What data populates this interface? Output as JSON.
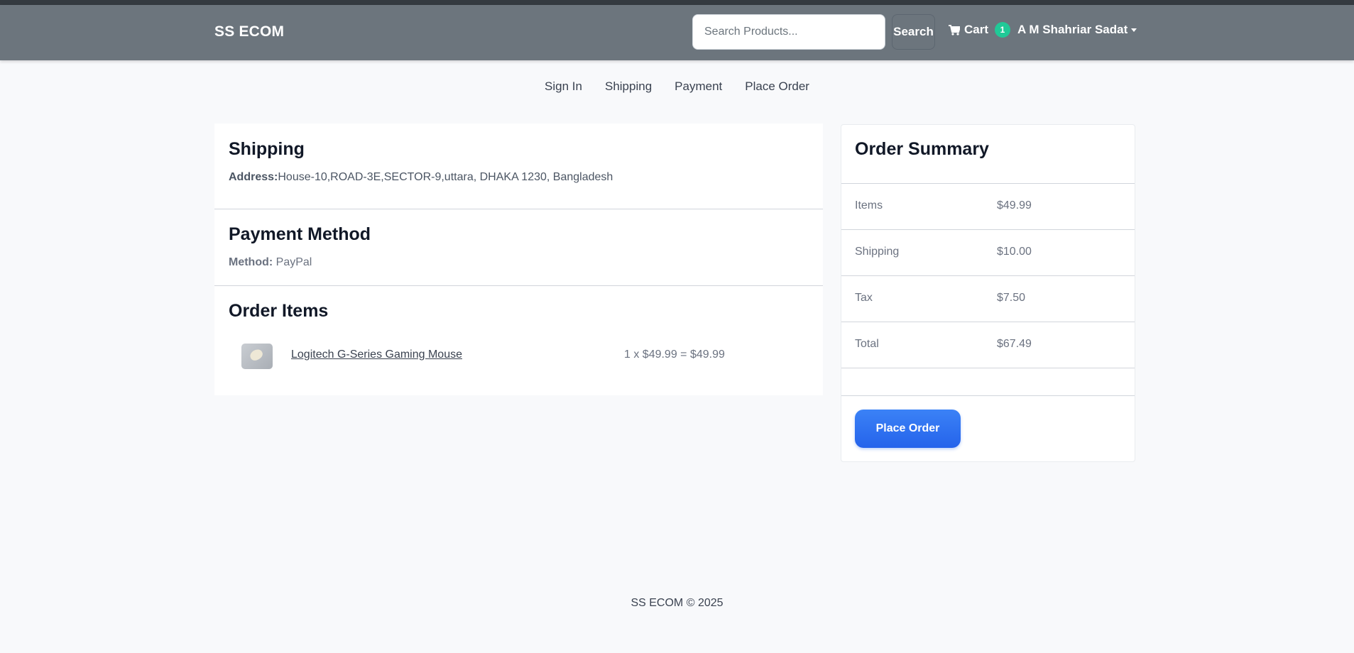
{
  "navbar": {
    "brand": "SS ECOM",
    "search": {
      "placeholder": "Search Products...",
      "button_label": "Search"
    },
    "cart": {
      "label": "Cart",
      "count": "1",
      "icon": "cart-icon"
    },
    "user": {
      "name": "A M Shahriar Sadat"
    }
  },
  "steps": [
    "Sign In",
    "Shipping",
    "Payment",
    "Place Order"
  ],
  "shipping": {
    "title": "Shipping",
    "address_label": "Address:",
    "address_value": "House-10,ROAD-3E,SECTOR-9,uttara, DHAKA 1230, Bangladesh"
  },
  "payment": {
    "title": "Payment Method",
    "method_label": "Method:",
    "method_value": "PayPal"
  },
  "order_items": {
    "title": "Order Items",
    "items": [
      {
        "name": "Logitech G-Series Gaming Mouse",
        "calc": "1 x $49.99 = $49.99"
      }
    ]
  },
  "summary": {
    "title": "Order Summary",
    "rows": [
      {
        "label": "Items",
        "value": "$49.99"
      },
      {
        "label": "Shipping",
        "value": "$10.00"
      },
      {
        "label": "Tax",
        "value": "$7.50"
      },
      {
        "label": "Total",
        "value": "$67.49"
      }
    ],
    "button_label": "Place Order"
  },
  "footer": {
    "text": "SS ECOM © 2025"
  }
}
